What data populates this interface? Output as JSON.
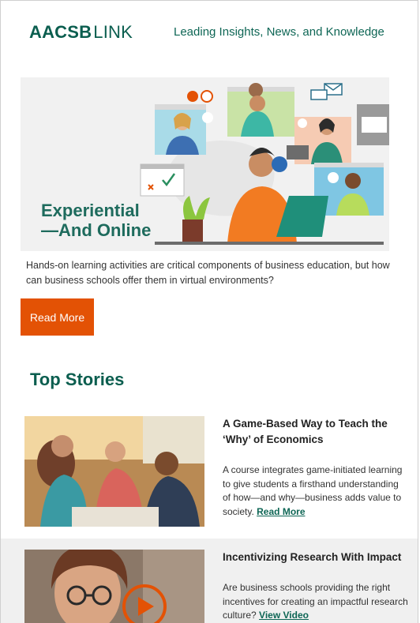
{
  "header": {
    "logo_bold": "AACSB",
    "logo_light": "LINK",
    "tagline": "Leading Insights, News, and Knowledge"
  },
  "hero": {
    "title_line1": "Experiential",
    "title_line2": "—And Online",
    "description": "Hands-on learning activities are critical components of business education, but how can business schools offer them in virtual environments?",
    "cta_label": "Read More"
  },
  "top_stories": {
    "heading": "Top Stories",
    "items": [
      {
        "title": "A Game-Based Way to Teach the ‘Why’ of Economics",
        "body": "A course integrates game-initiated learning to give students a firsthand understanding of how—and why—business adds value to society.",
        "link_label": "Read More"
      },
      {
        "title": "Incentivizing Research With Impact",
        "body": "Are business schools providing the right incentives for creating an impactful research culture?",
        "link_label": "View Video"
      }
    ]
  },
  "colors": {
    "brand_green": "#0b5e4f",
    "cta_orange": "#e35205"
  }
}
